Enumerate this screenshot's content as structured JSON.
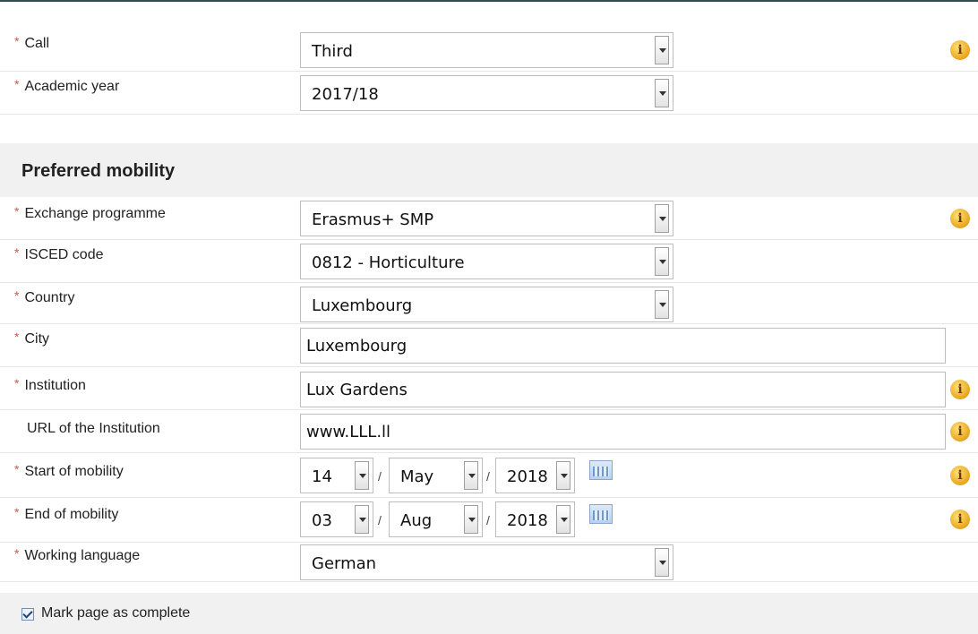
{
  "form": {
    "call": {
      "label": "Call",
      "value": "Third"
    },
    "academic_year": {
      "label": "Academic year",
      "value": "2017/18"
    }
  },
  "preferred_mobility": {
    "title": "Preferred mobility",
    "exchange_programme": {
      "label": "Exchange programme",
      "value": "Erasmus+ SMP"
    },
    "isced_code": {
      "label": "ISCED code",
      "value": "0812 - Horticulture"
    },
    "country": {
      "label": "Country",
      "value": "Luxembourg"
    },
    "city": {
      "label": "City",
      "value": "Luxembourg"
    },
    "institution": {
      "label": "Institution",
      "value": "Lux Gardens"
    },
    "url": {
      "label": "URL of the Institution",
      "value": "www.LLL.ll"
    },
    "start": {
      "label": "Start of mobility",
      "day": "14",
      "month": "May",
      "year": "2018"
    },
    "end": {
      "label": "End of mobility",
      "day": "03",
      "month": "Aug",
      "year": "2018"
    },
    "working_language": {
      "label": "Working language",
      "value": "German"
    }
  },
  "footer": {
    "mark_complete_label": "Mark page as complete",
    "mark_complete_checked": true
  },
  "common": {
    "required_mark": "*",
    "date_separator": "/",
    "info_glyph": "i"
  },
  "colors": {
    "required": "#d9534f",
    "info": "#e8a41c",
    "section_bg": "#f1f1f1"
  }
}
